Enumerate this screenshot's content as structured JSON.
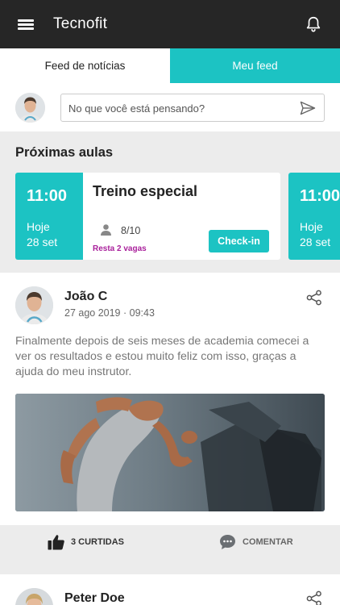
{
  "header": {
    "title": "Tecnofit",
    "menu_icon": "hamburger-menu-icon",
    "bell_icon": "bell-icon"
  },
  "tabs": [
    {
      "label": "Feed de notícias",
      "active": true
    },
    {
      "label": "Meu feed",
      "active": false
    }
  ],
  "composer": {
    "placeholder": "No que você está pensando?",
    "send_icon": "send-icon"
  },
  "classes": {
    "title": "Próximas aulas",
    "cards": [
      {
        "time": "11:00",
        "day": "Hoje",
        "date": "28 set",
        "name": "Treino especial",
        "count": "8/10",
        "vagas": "Resta 2 vagas",
        "checkin_label": "Check-in"
      },
      {
        "time": "11:00",
        "day": "Hoje",
        "date": "28 set"
      }
    ]
  },
  "posts": [
    {
      "author": "João C",
      "time": "27 ago 2019 · 09:43",
      "text": "Finalmente depois de seis meses de academia comecei a ver os resultados e estou muito feliz com isso, graças a ajuda do meu instrutor.",
      "likes_label": "3 CURTIDAS",
      "comment_label": "COMENTAR"
    },
    {
      "author": "Peter Doe"
    }
  ],
  "colors": {
    "accent": "#1cc3c3",
    "topbar": "#262626",
    "vagas": "#a91f9b",
    "background": "#ececec"
  }
}
